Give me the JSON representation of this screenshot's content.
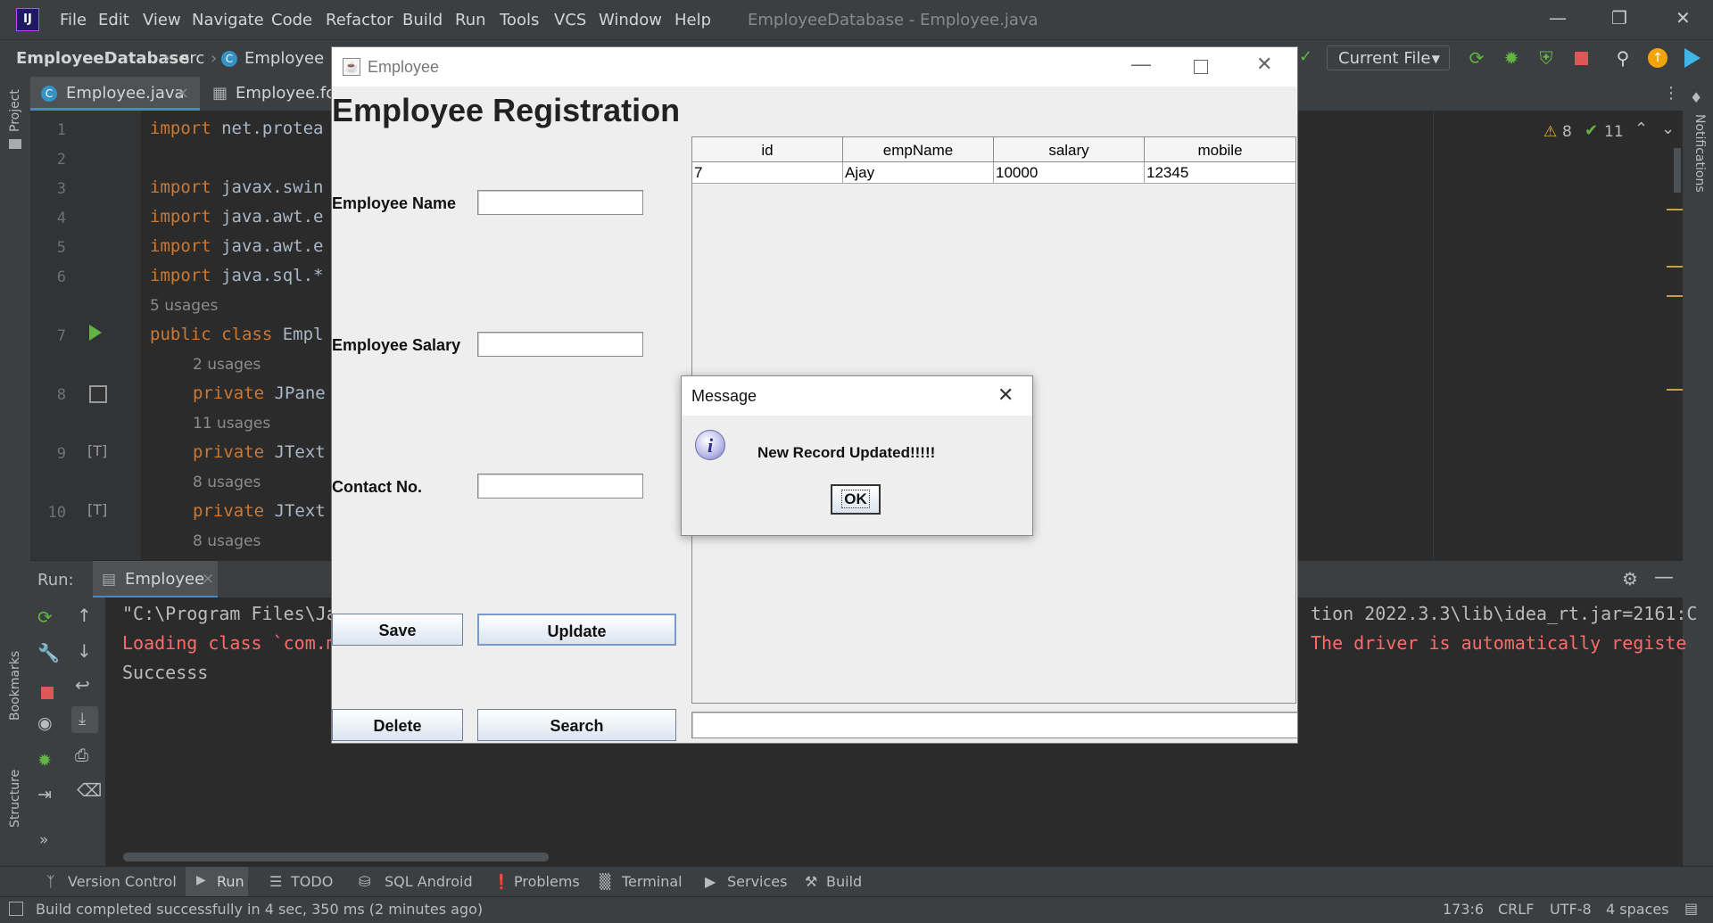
{
  "menubar": {
    "items": [
      "File",
      "Edit",
      "View",
      "Navigate",
      "Code",
      "Refactor",
      "Build",
      "Run",
      "Tools",
      "VCS",
      "Window",
      "Help"
    ],
    "window_title": "EmployeeDatabase - Employee.java"
  },
  "navbar": {
    "project": "EmployeeDatabase",
    "folder": "src",
    "file": "Employee",
    "run_config": "Current File"
  },
  "tabs": [
    "Employee.java",
    "Employee.for"
  ],
  "side_labels": {
    "project": "Project",
    "bookmarks": "Bookmarks",
    "structure": "Structure",
    "notifications": "Notifications"
  },
  "editor": {
    "warnings": "8",
    "checks": "11",
    "lines": [
      {
        "n": "1",
        "kw": "import ",
        "rest": "net.protea"
      },
      {
        "n": "2",
        "kw": "",
        "rest": ""
      },
      {
        "n": "3",
        "kw": "import ",
        "rest": "javax.swin"
      },
      {
        "n": "4",
        "kw": "import ",
        "rest": "java.awt.e"
      },
      {
        "n": "5",
        "kw": "import ",
        "rest": "java.awt.e"
      },
      {
        "n": "6",
        "kw": "import ",
        "rest": "java.sql.*"
      },
      {
        "n": "7",
        "kw": "public class ",
        "rest": "Empl"
      },
      {
        "n": "8",
        "kw": "private ",
        "rest": "JPane"
      },
      {
        "n": "9",
        "kw": "private ",
        "rest": "JText"
      },
      {
        "n": "10",
        "kw": "private ",
        "rest": "JText"
      }
    ],
    "hints": [
      "5 usages",
      "2 usages",
      "11 usages",
      "8 usages",
      "8 usages"
    ]
  },
  "run": {
    "label": "Run:",
    "tab": "Employee",
    "console": [
      {
        "left": "\"C:\\Program Files\\Ja",
        "right": "tion 2022.3.3\\lib\\idea_rt.jar=2161:C",
        "color": "#bbbbbb"
      },
      {
        "left": "Loading class `com.m",
        "right": "The driver is automatically registe",
        "color": "#ff6b68"
      },
      {
        "left": "Successs",
        "right": "",
        "color": "#bbbbbb"
      }
    ]
  },
  "bottom_tabs": [
    "Version Control",
    "Run",
    "TODO",
    "SQL Android",
    "Problems",
    "Terminal",
    "Services",
    "Build"
  ],
  "status": {
    "message": "Build completed successfully in 4 sec, 350 ms (2 minutes ago)",
    "position": "173:6",
    "line_sep": "CRLF",
    "encoding": "UTF-8",
    "indent": "4 spaces"
  },
  "employee_window": {
    "title": "Employee",
    "heading": "Employee Registration",
    "name_label": "Employee Name",
    "salary_label": "Employee Salary",
    "contact_label": "Contact No.",
    "name_value": "",
    "salary_value": "",
    "contact_value": "",
    "save": "Save",
    "update": "Upldate",
    "delete": "Delete",
    "search": "Search",
    "search_value": "",
    "table": {
      "columns": [
        "id",
        "empName",
        "salary",
        "mobile"
      ],
      "rows": [
        [
          "7",
          "Ajay",
          "10000",
          "12345"
        ]
      ]
    }
  },
  "message_dialog": {
    "title": "Message",
    "text": "New Record Updated!!!!!",
    "ok": "OK"
  }
}
